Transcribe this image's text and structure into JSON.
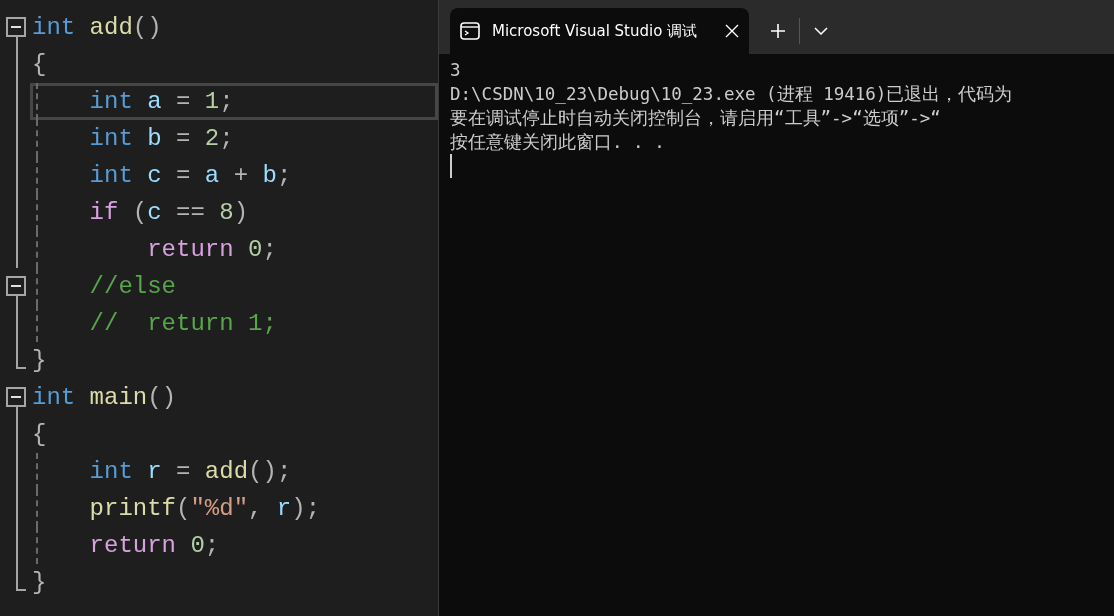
{
  "editor": {
    "lines": [
      {
        "kind": "opener",
        "highlighted": false,
        "tokens": [
          {
            "text": "int",
            "kind": "keyword"
          },
          {
            "text": " add",
            "kind": "func"
          },
          {
            "text": "()",
            "kind": "punct"
          }
        ]
      },
      {
        "kind": "inner",
        "highlighted": false,
        "tokens": [
          {
            "text": "{",
            "kind": "punct"
          }
        ]
      },
      {
        "kind": "inner",
        "highlighted": true,
        "tokens": [
          {
            "text": "    int",
            "kind": "keyword"
          },
          {
            "text": " a",
            "kind": "var"
          },
          {
            "text": " = ",
            "kind": "punct"
          },
          {
            "text": "1",
            "kind": "num"
          },
          {
            "text": ";",
            "kind": "punct"
          }
        ]
      },
      {
        "kind": "inner",
        "highlighted": false,
        "tokens": [
          {
            "text": "    int",
            "kind": "keyword"
          },
          {
            "text": " b",
            "kind": "var"
          },
          {
            "text": " = ",
            "kind": "punct"
          },
          {
            "text": "2",
            "kind": "num"
          },
          {
            "text": ";",
            "kind": "punct"
          }
        ]
      },
      {
        "kind": "inner",
        "highlighted": false,
        "tokens": [
          {
            "text": "    int",
            "kind": "keyword"
          },
          {
            "text": " c",
            "kind": "var"
          },
          {
            "text": " = ",
            "kind": "punct"
          },
          {
            "text": "a",
            "kind": "var"
          },
          {
            "text": " + ",
            "kind": "punct"
          },
          {
            "text": "b",
            "kind": "var"
          },
          {
            "text": ";",
            "kind": "punct"
          }
        ]
      },
      {
        "kind": "inner",
        "highlighted": false,
        "tokens": [
          {
            "text": "    if",
            "kind": "control"
          },
          {
            "text": " (",
            "kind": "punct"
          },
          {
            "text": "c",
            "kind": "var"
          },
          {
            "text": " == ",
            "kind": "punct"
          },
          {
            "text": "8",
            "kind": "num"
          },
          {
            "text": ")",
            "kind": "punct"
          }
        ]
      },
      {
        "kind": "inner",
        "highlighted": false,
        "tokens": [
          {
            "text": "        return",
            "kind": "control"
          },
          {
            "text": " 0",
            "kind": "num"
          },
          {
            "text": ";",
            "kind": "punct"
          }
        ]
      },
      {
        "kind": "opener",
        "highlighted": false,
        "tokens": [
          {
            "text": "    //else",
            "kind": "comment"
          }
        ]
      },
      {
        "kind": "inner",
        "highlighted": false,
        "tokens": [
          {
            "text": "    //  return 1;",
            "kind": "comment"
          }
        ]
      },
      {
        "kind": "closer",
        "highlighted": false,
        "tokens": [
          {
            "text": "}",
            "kind": "punct"
          }
        ]
      },
      {
        "kind": "opener",
        "highlighted": false,
        "tokens": [
          {
            "text": "int",
            "kind": "keyword"
          },
          {
            "text": " main",
            "kind": "func"
          },
          {
            "text": "()",
            "kind": "punct"
          }
        ]
      },
      {
        "kind": "inner",
        "highlighted": false,
        "tokens": [
          {
            "text": "{",
            "kind": "punct"
          }
        ]
      },
      {
        "kind": "inner",
        "highlighted": false,
        "tokens": [
          {
            "text": "    int",
            "kind": "keyword"
          },
          {
            "text": " r",
            "kind": "var"
          },
          {
            "text": " = ",
            "kind": "punct"
          },
          {
            "text": "add",
            "kind": "func"
          },
          {
            "text": "();",
            "kind": "punct"
          }
        ]
      },
      {
        "kind": "inner",
        "highlighted": false,
        "tokens": [
          {
            "text": "    printf",
            "kind": "func"
          },
          {
            "text": "(",
            "kind": "punct"
          },
          {
            "text": "\"%d\"",
            "kind": "string"
          },
          {
            "text": ", ",
            "kind": "punct"
          },
          {
            "text": "r",
            "kind": "var"
          },
          {
            "text": ");",
            "kind": "punct"
          }
        ]
      },
      {
        "kind": "inner",
        "highlighted": false,
        "tokens": [
          {
            "text": "    return",
            "kind": "control"
          },
          {
            "text": " 0",
            "kind": "num"
          },
          {
            "text": ";",
            "kind": "punct"
          }
        ]
      },
      {
        "kind": "closer",
        "highlighted": false,
        "tokens": [
          {
            "text": "}",
            "kind": "punct"
          }
        ]
      }
    ]
  },
  "terminal": {
    "tab": {
      "title": "Microsoft Visual Studio 调试",
      "selected": true
    },
    "output": [
      "3",
      "D:\\CSDN\\10_23\\Debug\\10_23.exe (进程 19416)已退出，代码为",
      "要在调试停止时自动关闭控制台，请启用“工具”->“选项”->“",
      "按任意键关闭此窗口. . ."
    ]
  }
}
